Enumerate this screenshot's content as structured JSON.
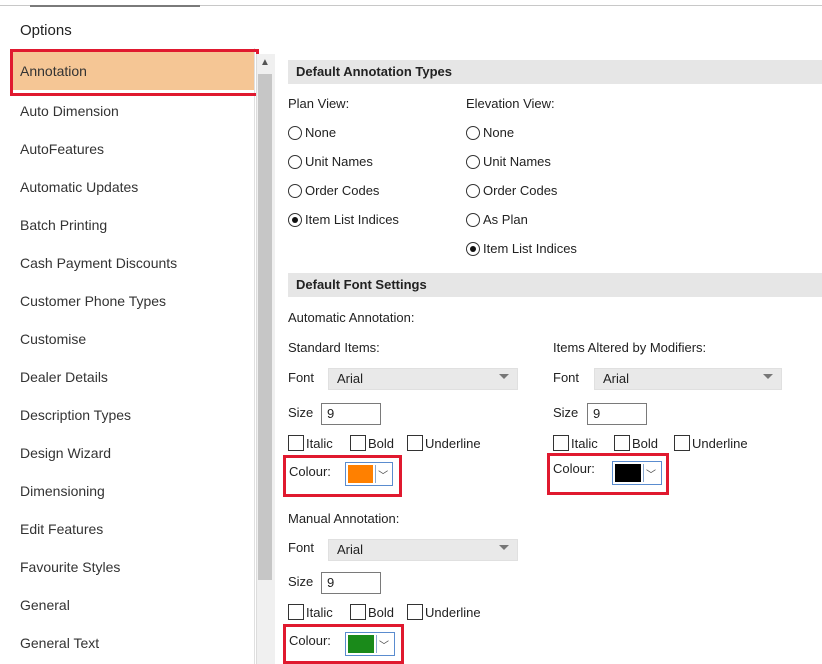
{
  "window": {
    "title": "Options"
  },
  "sidebar": {
    "items": [
      {
        "label": "Annotation",
        "selected": true
      },
      {
        "label": "Auto Dimension"
      },
      {
        "label": "AutoFeatures"
      },
      {
        "label": "Automatic Updates"
      },
      {
        "label": "Batch Printing"
      },
      {
        "label": "Cash Payment Discounts"
      },
      {
        "label": "Customer Phone Types"
      },
      {
        "label": "Customise"
      },
      {
        "label": "Dealer Details"
      },
      {
        "label": "Description Types"
      },
      {
        "label": "Design Wizard"
      },
      {
        "label": "Dimensioning"
      },
      {
        "label": "Edit Features"
      },
      {
        "label": "Favourite Styles"
      },
      {
        "label": "General"
      },
      {
        "label": "General Text"
      }
    ]
  },
  "default_annotation_types": {
    "header": "Default Annotation Types",
    "plan_view": {
      "label": "Plan View:",
      "options": [
        "None",
        "Unit Names",
        "Order Codes",
        "Item List Indices"
      ],
      "selected": "Item List Indices"
    },
    "elevation_view": {
      "label": "Elevation View:",
      "options": [
        "None",
        "Unit Names",
        "Order Codes",
        "As Plan",
        "Item List Indices"
      ],
      "selected": "Item List Indices"
    }
  },
  "default_font_settings": {
    "header": "Default Font Settings",
    "automatic_label": "Automatic Annotation:",
    "standard_items": {
      "label": "Standard Items:",
      "font_label": "Font",
      "font": "Arial",
      "size_label": "Size",
      "size": "9",
      "italic": "Italic",
      "bold": "Bold",
      "underline": "Underline",
      "colour_label": "Colour:",
      "colour": "#ff8000"
    },
    "altered_items": {
      "label": "Items Altered by Modifiers:",
      "font_label": "Font",
      "font": "Arial",
      "size_label": "Size",
      "size": "9",
      "italic": "Italic",
      "bold": "Bold",
      "underline": "Underline",
      "colour_label": "Colour:",
      "colour": "#000000"
    },
    "manual": {
      "label": "Manual Annotation:",
      "font_label": "Font",
      "font": "Arial",
      "size_label": "Size",
      "size": "9",
      "italic": "Italic",
      "bold": "Bold",
      "underline": "Underline",
      "colour_label": "Colour:",
      "colour": "#1a8a1a"
    }
  },
  "colors": {
    "selected_bg": "#f5c695",
    "highlight": "#e0192f"
  },
  "icons": {
    "scroll_up": "scroll-up-arrow-icon",
    "dropdown": "chevron-down-icon"
  }
}
